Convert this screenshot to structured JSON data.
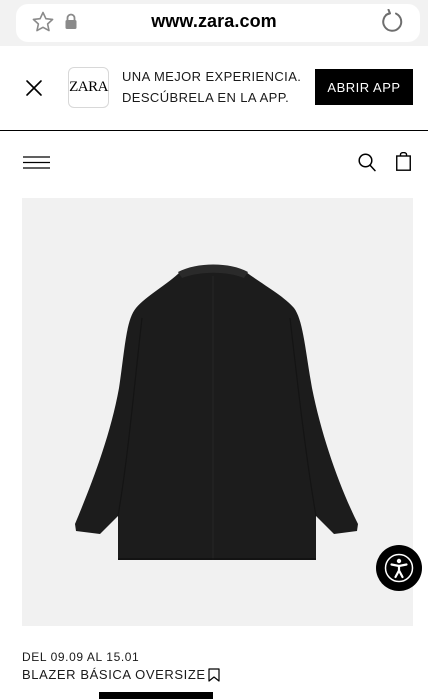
{
  "browser": {
    "url": "www.zara.com",
    "icons": [
      "star-icon",
      "lock-icon",
      "reload-icon"
    ]
  },
  "app_banner": {
    "logo_text": "ZARA",
    "line1": "UNA MEJOR EXPERIENCIA.",
    "line2": "DESCÚBRELA EN LA APP.",
    "open_button": "ABRIR APP",
    "icons": [
      "close-icon"
    ]
  },
  "header": {
    "icons": [
      "menu-icon",
      "search-icon",
      "bag-icon"
    ]
  },
  "product": {
    "date_range": "DEL 09.09 AL 15.01",
    "name": "BLAZER BÁSICA OVERSIZE",
    "image_alt": "black-blazer-image",
    "icons": [
      "bookmark-icon"
    ]
  },
  "accessibility": {
    "icon": "accessibility-icon"
  },
  "colors": {
    "brand_black": "#000000",
    "image_background": "#f1f1f1",
    "browser_bar": "#f2f2f2"
  }
}
